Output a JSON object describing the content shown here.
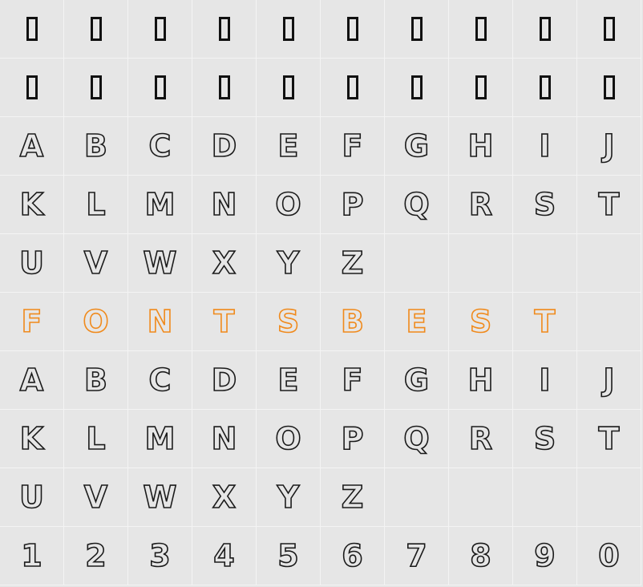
{
  "accent_color": "#f08a1c",
  "rows": [
    {
      "cells": [
        "",
        "",
        "",
        "",
        "",
        "",
        "",
        "",
        "",
        ""
      ],
      "style": "missing"
    },
    {
      "cells": [
        "",
        "",
        "",
        "",
        "",
        "",
        "",
        "",
        "",
        ""
      ],
      "style": "missing"
    },
    {
      "cells": [
        "A",
        "B",
        "C",
        "D",
        "E",
        "F",
        "G",
        "H",
        "I",
        "J"
      ],
      "style": "outline"
    },
    {
      "cells": [
        "K",
        "L",
        "M",
        "N",
        "O",
        "P",
        "Q",
        "R",
        "S",
        "T"
      ],
      "style": "outline"
    },
    {
      "cells": [
        "U",
        "V",
        "W",
        "X",
        "Y",
        "Z",
        "",
        "",
        "",
        ""
      ],
      "style": "outline"
    },
    {
      "cells": [
        "F",
        "O",
        "N",
        "T",
        "S",
        "B",
        "E",
        "S",
        "T",
        ""
      ],
      "style": "accent"
    },
    {
      "cells": [
        "A",
        "B",
        "C",
        "D",
        "E",
        "F",
        "G",
        "H",
        "I",
        "J"
      ],
      "style": "outline"
    },
    {
      "cells": [
        "K",
        "L",
        "M",
        "N",
        "O",
        "P",
        "Q",
        "R",
        "S",
        "T"
      ],
      "style": "outline"
    },
    {
      "cells": [
        "U",
        "V",
        "W",
        "X",
        "Y",
        "Z",
        "",
        "",
        "",
        ""
      ],
      "style": "outline"
    },
    {
      "cells": [
        "1",
        "2",
        "3",
        "4",
        "5",
        "6",
        "7",
        "8",
        "9",
        "0"
      ],
      "style": "outline"
    }
  ]
}
